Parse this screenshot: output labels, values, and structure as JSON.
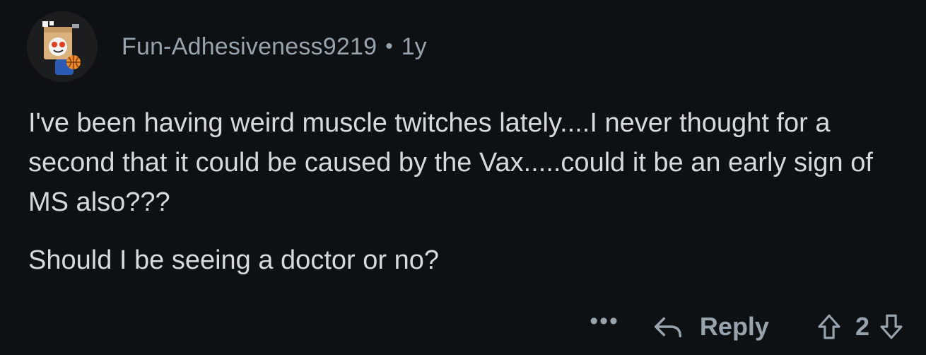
{
  "comment": {
    "author": "Fun-Adhesiveness9219",
    "separator": "•",
    "age": "1y",
    "paragraph_1": "I've been having weird muscle twitches lately....I never thought for a second that it could be caused by the Vax.....could it be an early sign of MS also???",
    "paragraph_2": "Should I be seeing a doctor or no?"
  },
  "actions": {
    "more_label": "•••",
    "reply_label": "Reply",
    "vote_count": "2"
  },
  "icons": {
    "avatar": "snoo-box-avatar",
    "reply": "reply-arrow-icon",
    "upvote": "upvote-arrow-icon",
    "downvote": "downvote-arrow-icon"
  },
  "colors": {
    "background": "#0e1113",
    "text": "#d7dadc",
    "meta": "#97a4ad"
  }
}
